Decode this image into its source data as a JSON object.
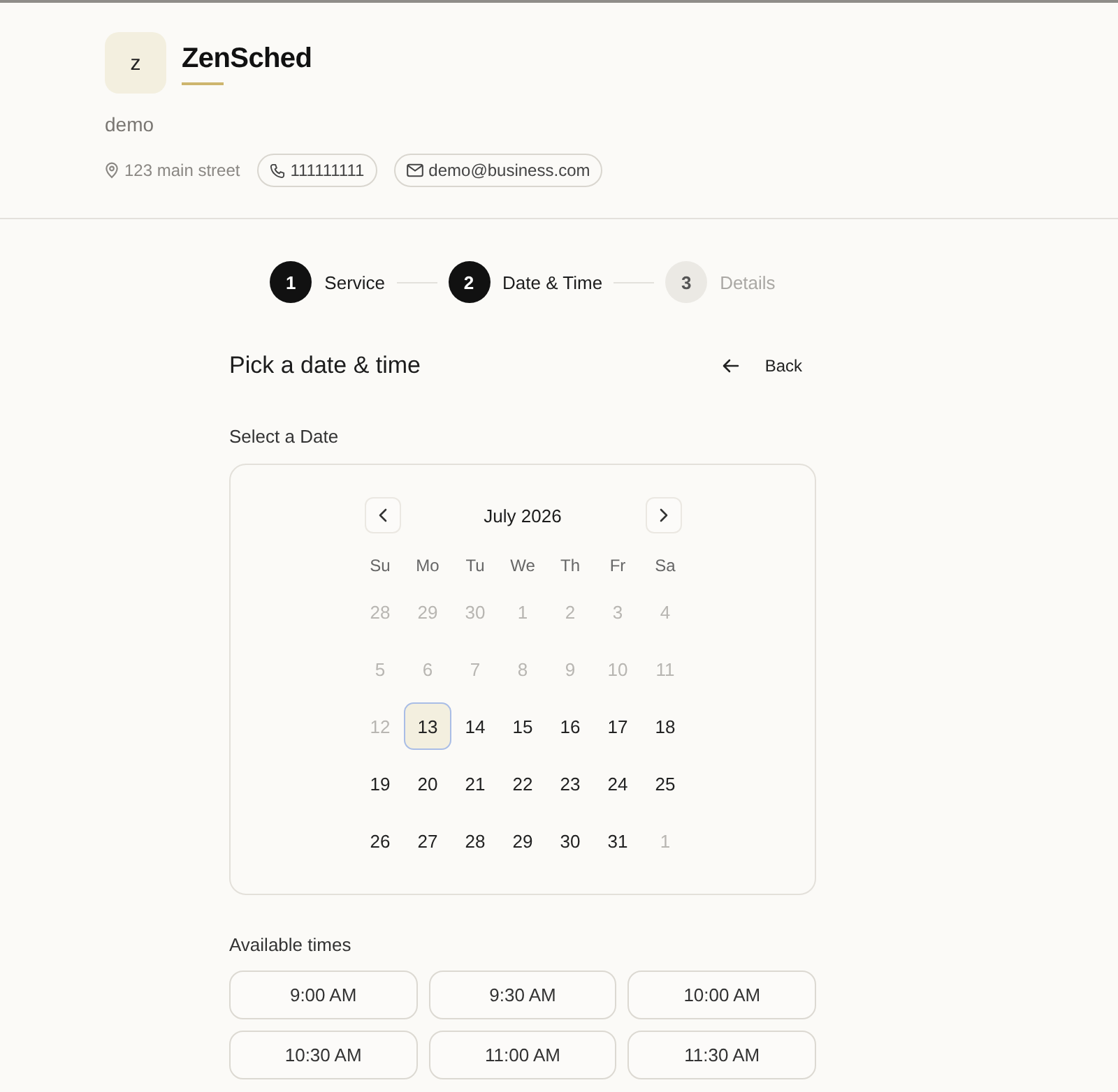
{
  "business": {
    "logo_letter": "z",
    "name": "ZenSched",
    "description": "demo",
    "address": "123 main street",
    "phone": "111111111",
    "email": "demo@business.com"
  },
  "steps": [
    {
      "number": "1",
      "label": "Service",
      "active": true
    },
    {
      "number": "2",
      "label": "Date & Time",
      "active": true
    },
    {
      "number": "3",
      "label": "Details",
      "active": false
    }
  ],
  "page": {
    "title": "Pick a date & time",
    "back_label": "Back"
  },
  "calendar": {
    "section_label": "Select a Date",
    "month": "July 2026",
    "weekdays": [
      "Su",
      "Mo",
      "Tu",
      "We",
      "Th",
      "Fr",
      "Sa"
    ],
    "weeks": [
      [
        {
          "day": "28",
          "disabled": true,
          "selected": false
        },
        {
          "day": "29",
          "disabled": true,
          "selected": false
        },
        {
          "day": "30",
          "disabled": true,
          "selected": false
        },
        {
          "day": "1",
          "disabled": true,
          "selected": false
        },
        {
          "day": "2",
          "disabled": true,
          "selected": false
        },
        {
          "day": "3",
          "disabled": true,
          "selected": false
        },
        {
          "day": "4",
          "disabled": true,
          "selected": false
        }
      ],
      [
        {
          "day": "5",
          "disabled": true,
          "selected": false
        },
        {
          "day": "6",
          "disabled": true,
          "selected": false
        },
        {
          "day": "7",
          "disabled": true,
          "selected": false
        },
        {
          "day": "8",
          "disabled": true,
          "selected": false
        },
        {
          "day": "9",
          "disabled": true,
          "selected": false
        },
        {
          "day": "10",
          "disabled": true,
          "selected": false
        },
        {
          "day": "11",
          "disabled": true,
          "selected": false
        }
      ],
      [
        {
          "day": "12",
          "disabled": true,
          "selected": false
        },
        {
          "day": "13",
          "disabled": false,
          "selected": true
        },
        {
          "day": "14",
          "disabled": false,
          "selected": false
        },
        {
          "day": "15",
          "disabled": false,
          "selected": false
        },
        {
          "day": "16",
          "disabled": false,
          "selected": false
        },
        {
          "day": "17",
          "disabled": false,
          "selected": false
        },
        {
          "day": "18",
          "disabled": false,
          "selected": false
        }
      ],
      [
        {
          "day": "19",
          "disabled": false,
          "selected": false
        },
        {
          "day": "20",
          "disabled": false,
          "selected": false
        },
        {
          "day": "21",
          "disabled": false,
          "selected": false
        },
        {
          "day": "22",
          "disabled": false,
          "selected": false
        },
        {
          "day": "23",
          "disabled": false,
          "selected": false
        },
        {
          "day": "24",
          "disabled": false,
          "selected": false
        },
        {
          "day": "25",
          "disabled": false,
          "selected": false
        }
      ],
      [
        {
          "day": "26",
          "disabled": false,
          "selected": false
        },
        {
          "day": "27",
          "disabled": false,
          "selected": false
        },
        {
          "day": "28",
          "disabled": false,
          "selected": false
        },
        {
          "day": "29",
          "disabled": false,
          "selected": false
        },
        {
          "day": "30",
          "disabled": false,
          "selected": false
        },
        {
          "day": "31",
          "disabled": false,
          "selected": false
        },
        {
          "day": "1",
          "disabled": true,
          "selected": false
        }
      ]
    ]
  },
  "times": {
    "section_label": "Available times",
    "slots": [
      {
        "label": "9:00 AM",
        "selected": false
      },
      {
        "label": "9:30 AM",
        "selected": false
      },
      {
        "label": "10:00 AM",
        "selected": false
      },
      {
        "label": "10:30 AM",
        "selected": false
      },
      {
        "label": "11:00 AM",
        "selected": false
      },
      {
        "label": "11:30 AM",
        "selected": false
      }
    ]
  }
}
